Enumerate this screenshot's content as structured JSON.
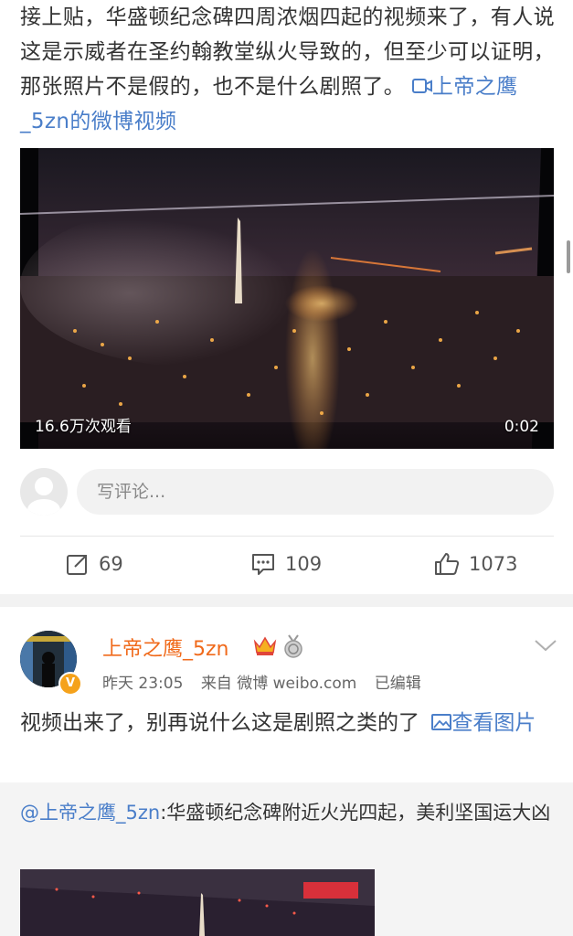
{
  "post1": {
    "text": "接上贴，华盛顿纪念碑四周浓烟四起的视频来了，有人说这是示威者在圣约翰教堂纵火导致的，但至少可以证明，那张照片不是假的，也不是什么剧照了。",
    "video_link": "上帝之鹰_5zn的微博视频",
    "video": {
      "views": "16.6万次观看",
      "duration": "0:02"
    }
  },
  "comment_box": {
    "placeholder": "写评论..."
  },
  "actions": {
    "repost": "69",
    "comment": "109",
    "like": "1073"
  },
  "post2": {
    "username": "上帝之鹰_5zn",
    "time": "昨天 23:05",
    "source": "来自 微博 weibo.com",
    "edited": "已编辑",
    "text": "视频出来了，别再说什么这是剧照之类的了",
    "img_link": "查看图片",
    "verified_mark": "V"
  },
  "repost": {
    "mention": "@上帝之鹰_5zn",
    "text": ":华盛顿纪念碑附近火光四起，美利坚国运大凶"
  },
  "colors": {
    "link": "#4a7ec9",
    "username": "#f06a1b",
    "bg_gap": "#f2f2f2"
  },
  "icons": [
    "video-link-icon",
    "repost-icon",
    "comment-icon",
    "like-icon",
    "crown-icon",
    "medal-icon",
    "chevron-down-icon",
    "image-link-icon"
  ]
}
